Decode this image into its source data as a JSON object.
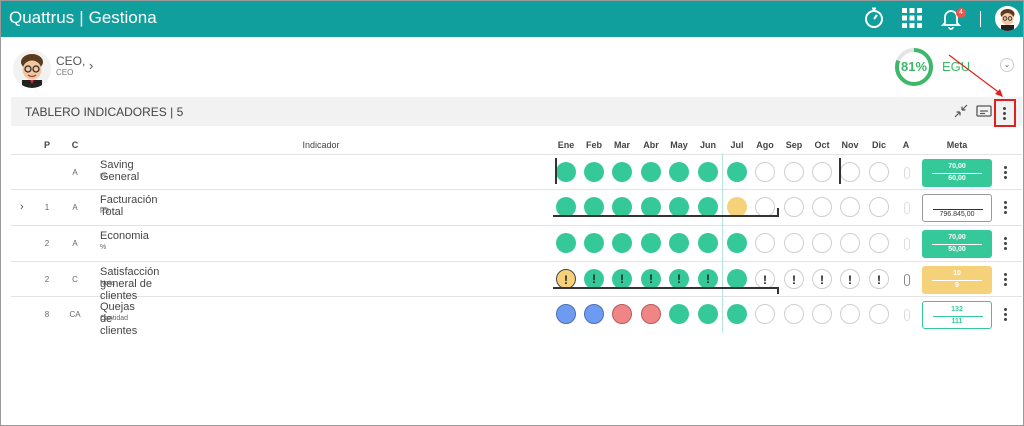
{
  "app": {
    "brand": "Quattrus",
    "module": "Gestiona",
    "notification_count": "4"
  },
  "user": {
    "name": "CEO,",
    "role": "CEO",
    "chevron": "›"
  },
  "progress": {
    "percent_label": "81%",
    "value": 0.81,
    "unit_label": "EGU",
    "collapse_glyph": "⌄"
  },
  "panel": {
    "title": "TABLERO INDICADORES | 5"
  },
  "table": {
    "headers": {
      "p": "P",
      "c": "C",
      "indicator": "Indicador",
      "months": [
        "Ene",
        "Feb",
        "Mar",
        "Abr",
        "May",
        "Jun",
        "Jul",
        "Ago",
        "Sep",
        "Oct",
        "Nov",
        "Dic"
      ],
      "a": "A",
      "meta": "Meta"
    },
    "rows": [
      {
        "p": "",
        "c": "A",
        "name": "Saving General",
        "unit": "%",
        "expand": "",
        "statuses": [
          "green",
          "green",
          "green",
          "green",
          "green",
          "green",
          "green",
          "empty",
          "empty",
          "empty",
          "empty",
          "empty"
        ],
        "meta_style": "green",
        "meta_v1": "70,00",
        "meta_v2": "60,00"
      },
      {
        "p": "1",
        "c": "A",
        "name": "Facturación Total",
        "unit": "R$",
        "expand": "›",
        "statuses": [
          "green",
          "green",
          "green",
          "green",
          "green",
          "green",
          "yellow",
          "empty",
          "empty",
          "empty",
          "empty",
          "empty"
        ],
        "meta_style": "white",
        "meta_v1": "",
        "meta_v2": "796.845,00"
      },
      {
        "p": "2",
        "c": "A",
        "name": "Economia",
        "unit": "%",
        "expand": "",
        "statuses": [
          "green",
          "green",
          "green",
          "green",
          "green",
          "green",
          "green",
          "empty",
          "empty",
          "empty",
          "empty",
          "empty"
        ],
        "meta_style": "green",
        "meta_v1": "70,00",
        "meta_v2": "50,00"
      },
      {
        "p": "2",
        "c": "C",
        "name": "Satisfacción general de clientes",
        "unit": "Nota",
        "expand": "",
        "statuses": [
          "warn-yellow",
          "warn-green",
          "warn-green",
          "warn-green",
          "warn-green",
          "warn-green",
          "green",
          "warn-empty",
          "warn-empty",
          "warn-empty",
          "warn-empty",
          "warn-empty"
        ],
        "meta_style": "yellow",
        "meta_v1": "10",
        "meta_v2": "9"
      },
      {
        "p": "8",
        "c": "CA",
        "name": "Quejas de clientes",
        "unit": "Cantidad",
        "expand": "",
        "statuses": [
          "blue",
          "blue",
          "red",
          "red",
          "green",
          "green",
          "green",
          "empty",
          "empty",
          "empty",
          "empty",
          "empty"
        ],
        "meta_style": "outline",
        "meta_v1": "132",
        "meta_v2": "111"
      }
    ]
  },
  "icons": {
    "timer": "stopwatch-icon",
    "apps": "apps-grid-icon",
    "bell": "bell-icon",
    "warning_mark": "!",
    "row_menu": "kebab-icon"
  },
  "colors": {
    "brand": "#119f9d",
    "green": "#35c99a",
    "yellow": "#f5d27a",
    "red": "#f08585",
    "blue": "#6d9bf2",
    "highlight": "#e02020"
  }
}
